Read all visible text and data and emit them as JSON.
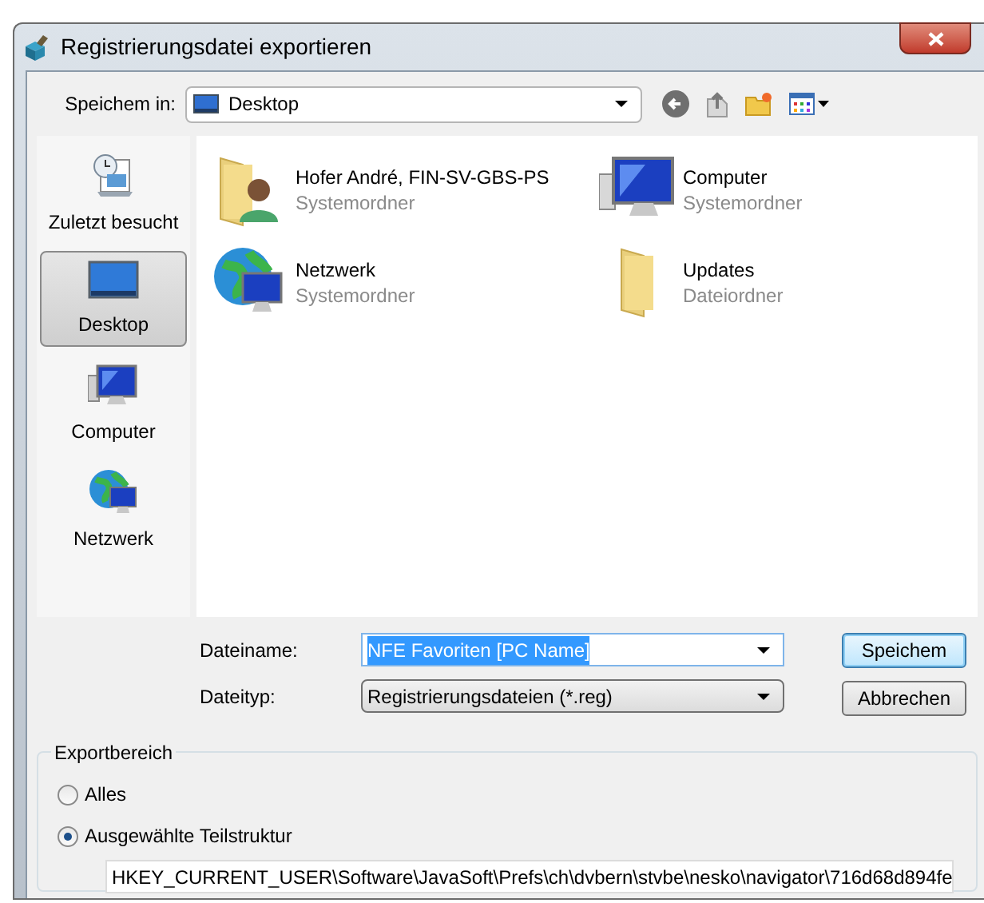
{
  "window": {
    "title": "Registrierungsdatei exportieren"
  },
  "save_in": {
    "label": "Speichem in:",
    "value": "Desktop"
  },
  "places": [
    {
      "label": "Zuletzt besucht",
      "kind": "recent",
      "selected": false
    },
    {
      "label": "Desktop",
      "kind": "desktop",
      "selected": true
    },
    {
      "label": "Computer",
      "kind": "computer",
      "selected": false
    },
    {
      "label": "Netzwerk",
      "kind": "network",
      "selected": false
    }
  ],
  "files": [
    {
      "name": "Hofer André, FIN-SV-GBS-PS",
      "type": "Systemordner",
      "kind": "user-folder"
    },
    {
      "name": "Computer",
      "type": "Systemordner",
      "kind": "computer"
    },
    {
      "name": "Netzwerk",
      "type": "Systemordner",
      "kind": "network"
    },
    {
      "name": "Updates",
      "type": "Dateiordner",
      "kind": "folder"
    }
  ],
  "filename": {
    "label": "Dateiname:",
    "value": "NFE Favoriten [PC Name]"
  },
  "filetype": {
    "label": "Dateityp:",
    "value": "Registrierungsdateien (*.reg)"
  },
  "buttons": [
    {
      "label": "Speichem",
      "default": true
    },
    {
      "label": "Abbrechen",
      "default": false
    }
  ],
  "export_range": {
    "title": "Exportbereich",
    "options": [
      {
        "label": "Alles",
        "selected": false
      },
      {
        "label": "Ausgewählte Teilstruktur",
        "selected": true
      }
    ],
    "path": "HKEY_CURRENT_USER\\Software\\JavaSoft\\Prefs\\ch\\dvbern\\stvbe\\nesko\\navigator\\716d68d894fe"
  }
}
